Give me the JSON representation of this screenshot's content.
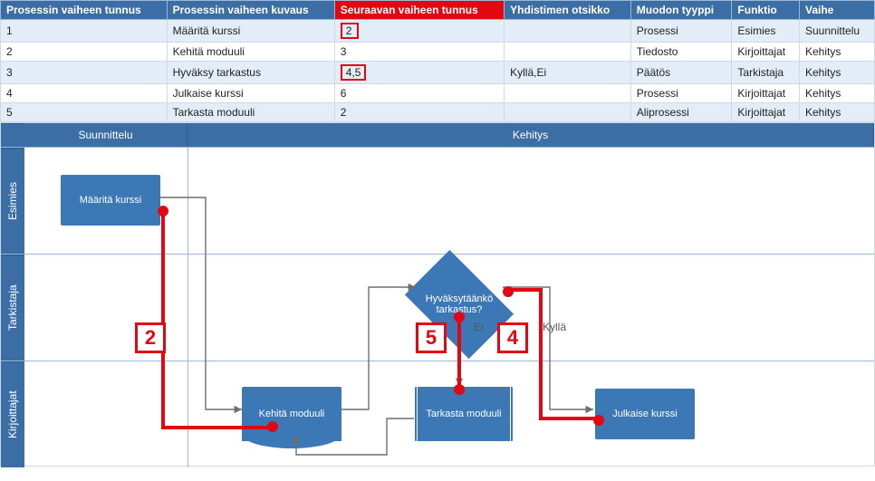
{
  "table": {
    "headers": {
      "c0": "Prosessin vaiheen tunnus",
      "c1": "Prosessin vaiheen kuvaus",
      "c2": "Seuraavan vaiheen tunnus",
      "c3": "Yhdistimen otsikko",
      "c4": "Muodon tyyppi",
      "c5": "Funktio",
      "c6": "Vaihe"
    },
    "rows": [
      {
        "c0": "1",
        "c1": "Määritä kurssi",
        "c2": "2",
        "c3": "",
        "c4": "Prosessi",
        "c5": "Esimies",
        "c6": "Suunnittelu",
        "bx": true
      },
      {
        "c0": "2",
        "c1": "Kehitä moduuli",
        "c2": "3",
        "c3": "",
        "c4": "Tiedosto",
        "c5": "Kirjoittajat",
        "c6": "Kehitys",
        "bx": false
      },
      {
        "c0": "3",
        "c1": "Hyväksy tarkastus",
        "c2": "4,5",
        "c3": "Kyllä,Ei",
        "c4": "Päätös",
        "c5": "Tarkistaja",
        "c6": "Kehitys",
        "bx": true
      },
      {
        "c0": "4",
        "c1": "Julkaise kurssi",
        "c2": "6",
        "c3": "",
        "c4": "Prosessi",
        "c5": "Kirjoittajat",
        "c6": "Kehitys",
        "bx": false
      },
      {
        "c0": "5",
        "c1": "Tarkasta moduuli",
        "c2": "2",
        "c3": "",
        "c4": "Aliprosessi",
        "c5": "Kirjoittajat",
        "c6": "Kehitys",
        "bx": false
      }
    ]
  },
  "phases": {
    "p1": "Suunnittelu",
    "p2": "Kehitys"
  },
  "lanes": {
    "l1": "Esimies",
    "l2": "Tarkistaja",
    "l3": "Kirjoittajat"
  },
  "shapes": {
    "s1": "Määritä kurssi",
    "s2": "Kehitä moduuli",
    "s3": "Hyväksytäänkö tarkastus?",
    "s4": "Julkaise kurssi",
    "s5": "Tarkasta moduuli"
  },
  "conn_labels": {
    "no": "Ei",
    "yes": "Kyllä"
  },
  "annot": {
    "a2": "2",
    "a5": "5",
    "a4": "4"
  }
}
